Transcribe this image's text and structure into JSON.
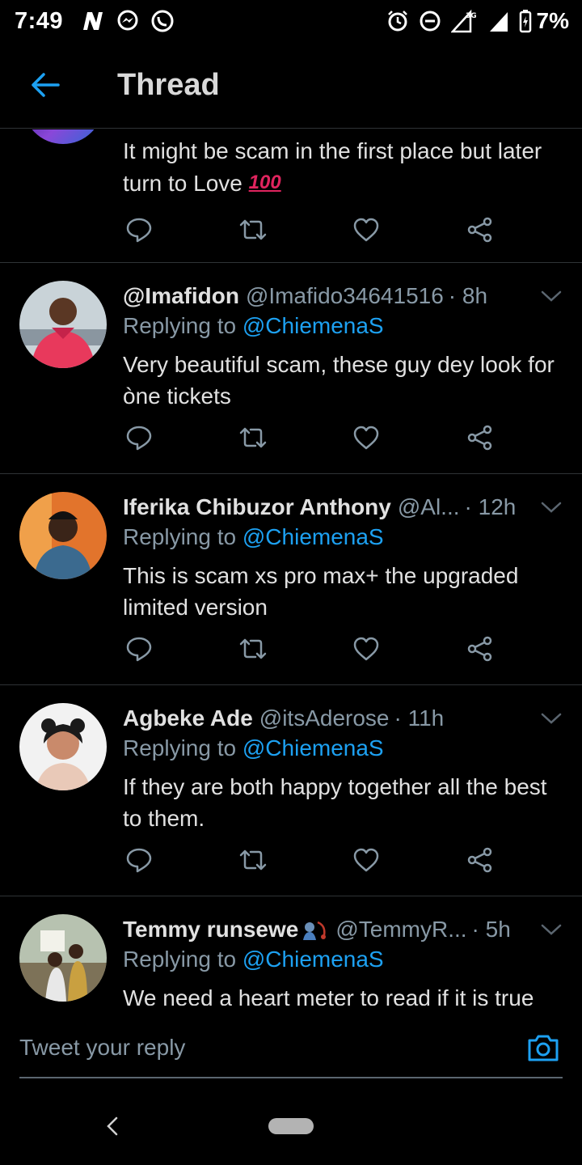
{
  "status_bar": {
    "time": "7:49",
    "battery": "7%",
    "network": "3G"
  },
  "header": {
    "title": "Thread"
  },
  "thread": {
    "top_tweet": {
      "text": "It might be scam in the first place but later turn to Love",
      "emoji": "💯"
    },
    "replies": [
      {
        "display_name": "@Imafidon",
        "handle": "@Imafido34641516",
        "time": "· 8h",
        "replying_prefix": "Replying to",
        "replying_to": "@ChiemenaS",
        "text": "Very beautiful scam, these guy dey look for òne tickets"
      },
      {
        "display_name": "Iferika Chibuzor Anthony",
        "handle": "@Al...",
        "time": "· 12h",
        "replying_prefix": "Replying to",
        "replying_to": "@ChiemenaS",
        "text": "This is scam xs pro max+ the upgraded limited version"
      },
      {
        "display_name": "Agbeke Ade",
        "handle": "@itsAderose",
        "time": "· 11h",
        "replying_prefix": "Replying to",
        "replying_to": "@ChiemenaS",
        "text": "If they are both happy together all the best to them."
      },
      {
        "display_name": "Temmy runsewe",
        "handle": "@TemmyR...",
        "time": "· 5h",
        "replying_prefix": "Replying to",
        "replying_to": "@ChiemenaS",
        "text": "We need a heart meter to read if it is true"
      }
    ]
  },
  "reply_bar": {
    "placeholder": "Tweet your reply"
  },
  "icons": [
    "back-arrow-icon",
    "reply-icon",
    "retweet-icon",
    "like-icon",
    "share-icon",
    "chevron-down-icon",
    "camera-icon",
    "alarm-icon",
    "dnd-icon",
    "signal-icon",
    "battery-icon"
  ],
  "colors": {
    "background": "#000000",
    "accent": "#1da1f2",
    "muted": "#8899a6",
    "text": "#e1e1e1",
    "divider": "#2f3336"
  }
}
